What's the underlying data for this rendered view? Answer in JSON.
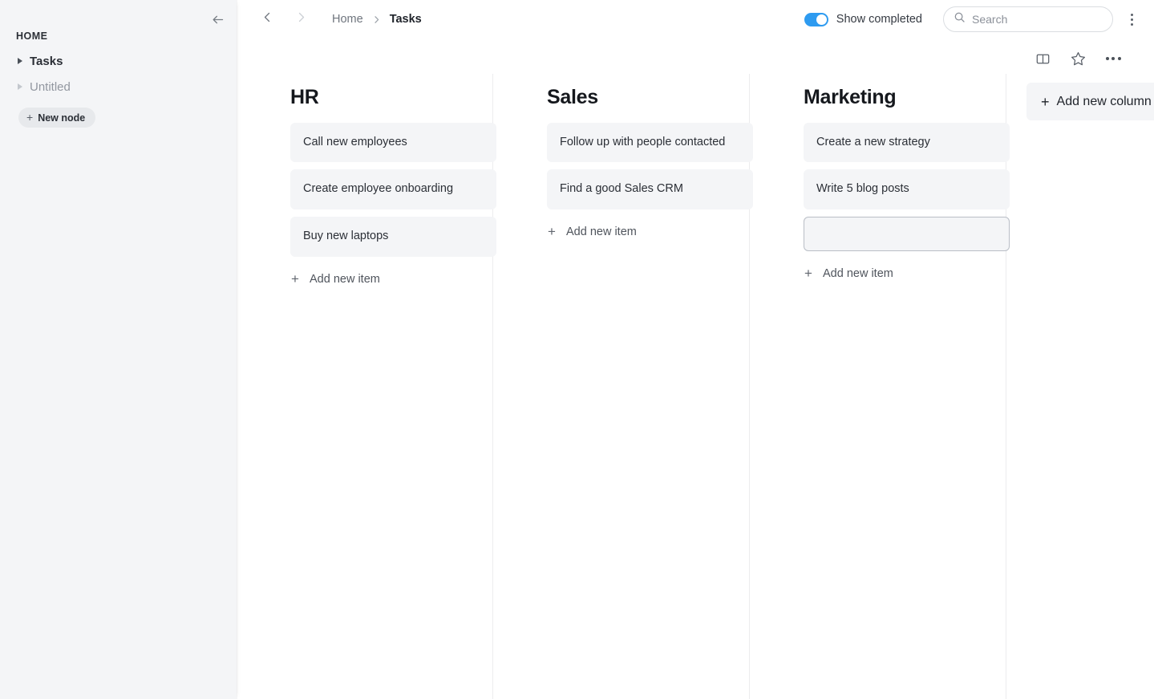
{
  "sidebar": {
    "collapse_icon": "arrow-left-icon",
    "section_title": "HOME",
    "items": [
      {
        "label": "Tasks",
        "active": true,
        "disclosure_icon": "triangle-right-icon"
      },
      {
        "label": "Untitled",
        "active": false,
        "disclosure_icon": "triangle-right-icon"
      }
    ],
    "new_node": {
      "label": "New node",
      "icon": "plus-icon"
    }
  },
  "topbar": {
    "back_icon": "chevron-left-icon",
    "forward_icon": "chevron-right-icon",
    "breadcrumb": [
      {
        "label": "Home",
        "current": false
      },
      {
        "label": "Tasks",
        "current": true
      }
    ],
    "breadcrumb_separator_icon": "chevron-right-icon",
    "toggle": {
      "label": "Show completed",
      "on": true,
      "accent_color": "#2e9bf0"
    },
    "search": {
      "value": "",
      "placeholder": "Search",
      "icon": "search-icon"
    },
    "overflow_icon": "more-vertical-icon"
  },
  "subtoolbar": {
    "buttons": [
      {
        "icon": "split-panel-icon",
        "name": "layout"
      },
      {
        "icon": "star-outline-icon",
        "name": "favorite"
      },
      {
        "icon": "more-horizontal-icon",
        "name": "more-options"
      }
    ]
  },
  "board": {
    "add_item_label": "Add new item",
    "add_item_icon": "plus-icon",
    "add_column": {
      "label": "Add new column",
      "icon": "plus-icon"
    },
    "columns": [
      {
        "title": "HR",
        "cards": [
          {
            "text": "Call new employees",
            "editing": false
          },
          {
            "text": "Create employee onboarding",
            "editing": false
          },
          {
            "text": "Buy new laptops",
            "editing": false
          }
        ]
      },
      {
        "title": "Sales",
        "cards": [
          {
            "text": "Follow up with people contacted",
            "editing": false
          },
          {
            "text": "Find a good Sales CRM",
            "editing": false
          }
        ]
      },
      {
        "title": "Marketing",
        "cards": [
          {
            "text": "Create a new strategy",
            "editing": false
          },
          {
            "text": "Write 5 blog posts",
            "editing": false
          },
          {
            "text": "",
            "editing": true
          }
        ]
      }
    ]
  },
  "colors": {
    "sidebar_bg": "#f4f5f7",
    "card_bg": "#f4f5f7",
    "accent": "#2e9bf0",
    "divider": "#ececee",
    "text_primary": "#1f232a",
    "text_muted": "#9297a0"
  }
}
